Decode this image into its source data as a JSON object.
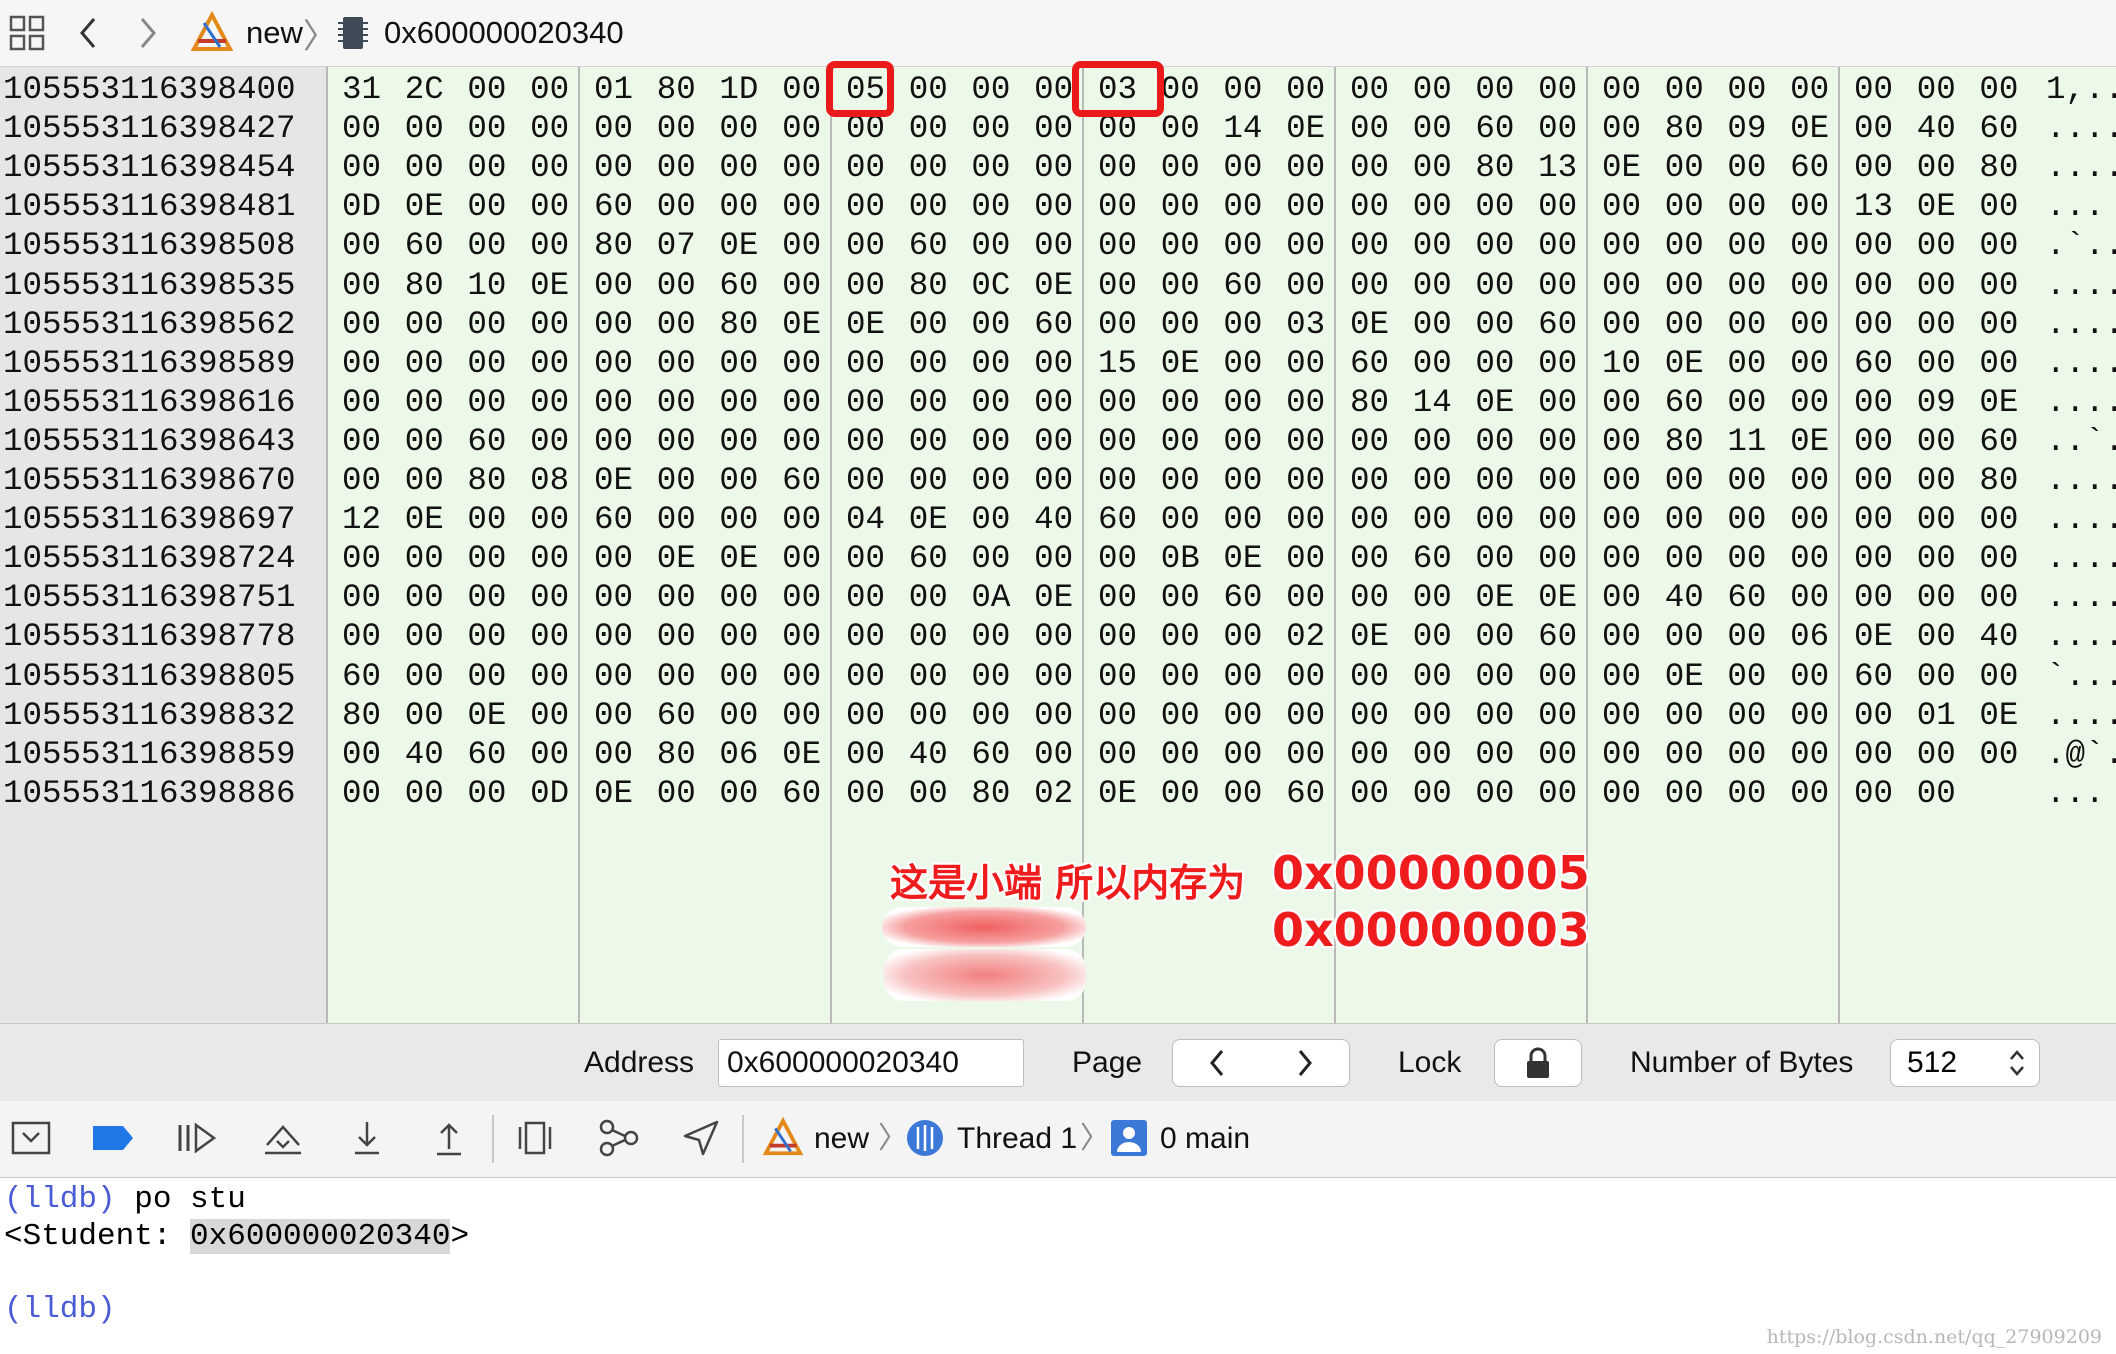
{
  "jumpbar": {
    "project": "new",
    "location": "0x600000020340"
  },
  "memory": {
    "rows": [
      {
        "address": "105553116398400",
        "bytes": [
          "31",
          "2C",
          "00",
          "00",
          "01",
          "80",
          "1D",
          "00",
          "05",
          "00",
          "00",
          "00",
          "03",
          "00",
          "00",
          "00",
          "00",
          "00",
          "00",
          "00",
          "00",
          "00",
          "00",
          "00",
          "00",
          "00",
          "00"
        ],
        "ascii": "1,.."
      },
      {
        "address": "105553116398427",
        "bytes": [
          "00",
          "00",
          "00",
          "00",
          "00",
          "00",
          "00",
          "00",
          "00",
          "00",
          "00",
          "00",
          "00",
          "00",
          "14",
          "0E",
          "00",
          "00",
          "60",
          "00",
          "00",
          "80",
          "09",
          "0E",
          "00",
          "40",
          "60"
        ],
        "ascii": "...."
      },
      {
        "address": "105553116398454",
        "bytes": [
          "00",
          "00",
          "00",
          "00",
          "00",
          "00",
          "00",
          "00",
          "00",
          "00",
          "00",
          "00",
          "00",
          "00",
          "00",
          "00",
          "00",
          "00",
          "80",
          "13",
          "0E",
          "00",
          "00",
          "60",
          "00",
          "00",
          "80"
        ],
        "ascii": "...."
      },
      {
        "address": "105553116398481",
        "bytes": [
          "0D",
          "0E",
          "00",
          "00",
          "60",
          "00",
          "00",
          "00",
          "00",
          "00",
          "00",
          "00",
          "00",
          "00",
          "00",
          "00",
          "00",
          "00",
          "00",
          "00",
          "00",
          "00",
          "00",
          "00",
          "13",
          "0E",
          "00"
        ],
        "ascii": "..."
      },
      {
        "address": "105553116398508",
        "bytes": [
          "00",
          "60",
          "00",
          "00",
          "80",
          "07",
          "0E",
          "00",
          "00",
          "60",
          "00",
          "00",
          "00",
          "00",
          "00",
          "00",
          "00",
          "00",
          "00",
          "00",
          "00",
          "00",
          "00",
          "00",
          "00",
          "00",
          "00"
        ],
        "ascii": ".`.."
      },
      {
        "address": "105553116398535",
        "bytes": [
          "00",
          "80",
          "10",
          "0E",
          "00",
          "00",
          "60",
          "00",
          "00",
          "80",
          "0C",
          "0E",
          "00",
          "00",
          "60",
          "00",
          "00",
          "00",
          "00",
          "00",
          "00",
          "00",
          "00",
          "00",
          "00",
          "00",
          "00"
        ],
        "ascii": "...."
      },
      {
        "address": "105553116398562",
        "bytes": [
          "00",
          "00",
          "00",
          "00",
          "00",
          "00",
          "80",
          "0E",
          "0E",
          "00",
          "00",
          "60",
          "00",
          "00",
          "00",
          "03",
          "0E",
          "00",
          "00",
          "60",
          "00",
          "00",
          "00",
          "00",
          "00",
          "00",
          "00"
        ],
        "ascii": "...."
      },
      {
        "address": "105553116398589",
        "bytes": [
          "00",
          "00",
          "00",
          "00",
          "00",
          "00",
          "00",
          "00",
          "00",
          "00",
          "00",
          "00",
          "15",
          "0E",
          "00",
          "00",
          "60",
          "00",
          "00",
          "00",
          "10",
          "0E",
          "00",
          "00",
          "60",
          "00",
          "00"
        ],
        "ascii": "...."
      },
      {
        "address": "105553116398616",
        "bytes": [
          "00",
          "00",
          "00",
          "00",
          "00",
          "00",
          "00",
          "00",
          "00",
          "00",
          "00",
          "00",
          "00",
          "00",
          "00",
          "00",
          "80",
          "14",
          "0E",
          "00",
          "00",
          "60",
          "00",
          "00",
          "00",
          "09",
          "0E"
        ],
        "ascii": "...."
      },
      {
        "address": "105553116398643",
        "bytes": [
          "00",
          "00",
          "60",
          "00",
          "00",
          "00",
          "00",
          "00",
          "00",
          "00",
          "00",
          "00",
          "00",
          "00",
          "00",
          "00",
          "00",
          "00",
          "00",
          "00",
          "00",
          "80",
          "11",
          "0E",
          "00",
          "00",
          "60"
        ],
        "ascii": "..`."
      },
      {
        "address": "105553116398670",
        "bytes": [
          "00",
          "00",
          "80",
          "08",
          "0E",
          "00",
          "00",
          "60",
          "00",
          "00",
          "00",
          "00",
          "00",
          "00",
          "00",
          "00",
          "00",
          "00",
          "00",
          "00",
          "00",
          "00",
          "00",
          "00",
          "00",
          "00",
          "80"
        ],
        "ascii": "...."
      },
      {
        "address": "105553116398697",
        "bytes": [
          "12",
          "0E",
          "00",
          "00",
          "60",
          "00",
          "00",
          "00",
          "04",
          "0E",
          "00",
          "40",
          "60",
          "00",
          "00",
          "00",
          "00",
          "00",
          "00",
          "00",
          "00",
          "00",
          "00",
          "00",
          "00",
          "00",
          "00"
        ],
        "ascii": "...."
      },
      {
        "address": "105553116398724",
        "bytes": [
          "00",
          "00",
          "00",
          "00",
          "00",
          "0E",
          "0E",
          "00",
          "00",
          "60",
          "00",
          "00",
          "00",
          "0B",
          "0E",
          "00",
          "00",
          "60",
          "00",
          "00",
          "00",
          "00",
          "00",
          "00",
          "00",
          "00",
          "00"
        ],
        "ascii": "...."
      },
      {
        "address": "105553116398751",
        "bytes": [
          "00",
          "00",
          "00",
          "00",
          "00",
          "00",
          "00",
          "00",
          "00",
          "00",
          "0A",
          "0E",
          "00",
          "00",
          "60",
          "00",
          "00",
          "00",
          "0E",
          "0E",
          "00",
          "40",
          "60",
          "00",
          "00",
          "00",
          "00"
        ],
        "ascii": "...."
      },
      {
        "address": "105553116398778",
        "bytes": [
          "00",
          "00",
          "00",
          "00",
          "00",
          "00",
          "00",
          "00",
          "00",
          "00",
          "00",
          "00",
          "00",
          "00",
          "00",
          "02",
          "0E",
          "00",
          "00",
          "60",
          "00",
          "00",
          "00",
          "06",
          "0E",
          "00",
          "40"
        ],
        "ascii": "...."
      },
      {
        "address": "105553116398805",
        "bytes": [
          "60",
          "00",
          "00",
          "00",
          "00",
          "00",
          "00",
          "00",
          "00",
          "00",
          "00",
          "00",
          "00",
          "00",
          "00",
          "00",
          "00",
          "00",
          "00",
          "00",
          "00",
          "0E",
          "00",
          "00",
          "60",
          "00",
          "00"
        ],
        "ascii": "`..."
      },
      {
        "address": "105553116398832",
        "bytes": [
          "80",
          "00",
          "0E",
          "00",
          "00",
          "60",
          "00",
          "00",
          "00",
          "00",
          "00",
          "00",
          "00",
          "00",
          "00",
          "00",
          "00",
          "00",
          "00",
          "00",
          "00",
          "00",
          "00",
          "00",
          "00",
          "01",
          "0E"
        ],
        "ascii": "...."
      },
      {
        "address": "105553116398859",
        "bytes": [
          "00",
          "40",
          "60",
          "00",
          "00",
          "80",
          "06",
          "0E",
          "00",
          "40",
          "60",
          "00",
          "00",
          "00",
          "00",
          "00",
          "00",
          "00",
          "00",
          "00",
          "00",
          "00",
          "00",
          "00",
          "00",
          "00",
          "00"
        ],
        "ascii": ".@`."
      },
      {
        "address": "105553116398886",
        "bytes": [
          "00",
          "00",
          "00",
          "0D",
          "0E",
          "00",
          "00",
          "60",
          "00",
          "00",
          "80",
          "02",
          "0E",
          "00",
          "00",
          "60",
          "00",
          "00",
          "00",
          "00",
          "00",
          "00",
          "00",
          "00",
          "00",
          "00",
          ""
        ],
        "ascii": "..."
      }
    ]
  },
  "annotations": {
    "line1_prefix": "这是小端 所以内存为",
    "line1_value": "0x00000005",
    "line2_value": "0x00000003"
  },
  "bottombar": {
    "address_label": "Address",
    "address_value": "0x600000020340",
    "page_label": "Page",
    "lock_label": "Lock",
    "bytes_label": "Number of Bytes",
    "bytes_value": "512"
  },
  "debugbar": {
    "process": "new",
    "thread": "Thread 1",
    "frame": "0 main"
  },
  "console": {
    "prompt": "(lldb)",
    "command": " po stu",
    "output_prefix": "<Student: ",
    "output_address": "0x600000020340",
    "output_suffix": ">"
  },
  "watermark": "https://blog.csdn.net/qq_27909209",
  "colors": {
    "highlight": "#ea1a1a",
    "prompt": "#4a5bd6",
    "memory_bg": "#ecf8e8"
  }
}
